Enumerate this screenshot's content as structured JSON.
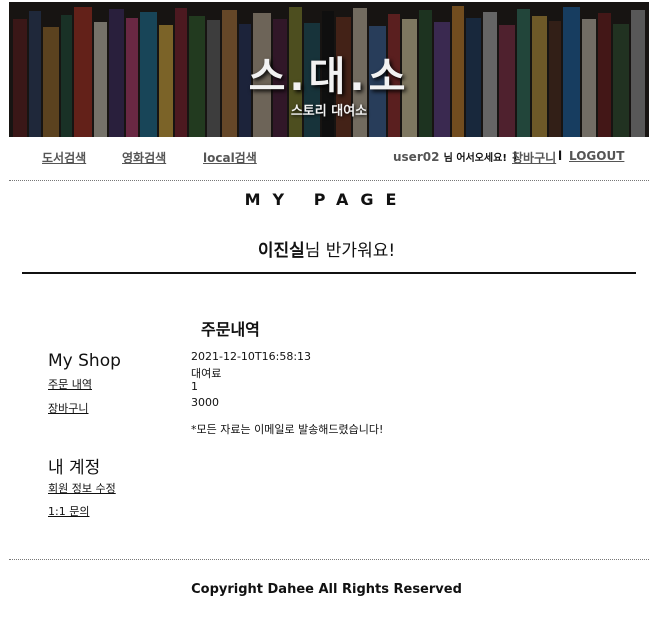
{
  "banner": {
    "logo_text": "스.대.소",
    "subtitle": "스토리 대여소"
  },
  "nav": {
    "book_search": "도서검색",
    "movie_search": "영화검색",
    "local_search": "local검색",
    "user_id": "user02",
    "welcome": "님 어서오세요!",
    "separator": "l",
    "cart": "장바구니",
    "logout": "LOGOUT"
  },
  "page": {
    "title": "MY PAGE",
    "greeting_name": "이진실",
    "greeting_rest": "님 반가워요!"
  },
  "sidebar": {
    "shop_heading": "My Shop",
    "order_history": "주문 내역",
    "cart": "장바구니",
    "account_heading": "내 계정",
    "edit_info": "회원 정보 수정",
    "inquiry": "1:1 문의"
  },
  "orders": {
    "title": "주문내역",
    "date": "2021-12-10T16:58:13",
    "type": "대여료",
    "quantity": "1",
    "price": "3000",
    "notice": "*모든 자료는 이메일로 발송해드렸습니다!"
  },
  "footer": {
    "copyright": "Copyright Dahee All Rights Reserved"
  }
}
